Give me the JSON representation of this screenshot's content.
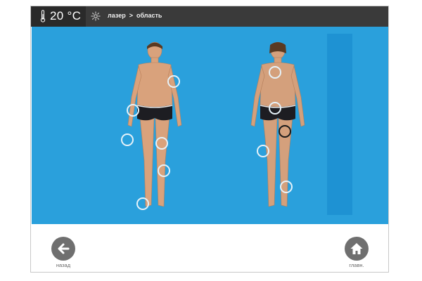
{
  "header": {
    "temperature": "20 °C",
    "breadcrumb": {
      "first": "лазер",
      "separator": ">",
      "second": "область"
    }
  },
  "footer": {
    "back_label": "назад",
    "home_label": "главн."
  },
  "icons": {
    "thermometer": "thermometer-icon",
    "mode": "laser-mode-icon",
    "back": "arrow-left-icon",
    "home": "home-icon"
  },
  "colors": {
    "accent_blue": "#2aa0dc",
    "zone_ring": "#e6f2f9",
    "zone_active": "#1a1a1a",
    "button_gray": "#6f6f6f"
  }
}
